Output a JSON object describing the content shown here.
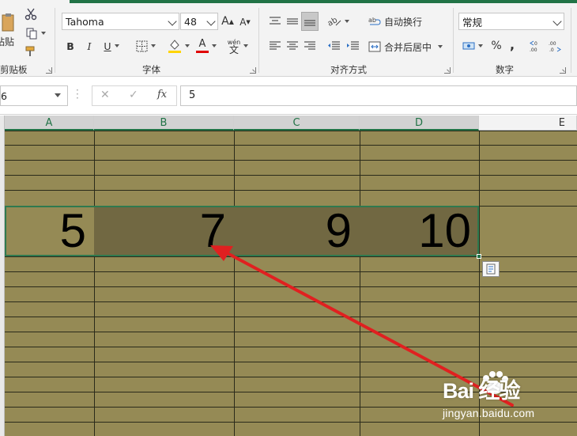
{
  "ribbon": {
    "clipboard": {
      "paste_label": "粘贴",
      "group_label": "剪贴板"
    },
    "font": {
      "font_name": "Tahoma",
      "font_size": "48",
      "grow_font": "A",
      "shrink_font": "A",
      "bold": "B",
      "italic": "I",
      "underline": "U",
      "font_color_glyph": "A",
      "phonetic": "wén",
      "group_label": "字体"
    },
    "alignment": {
      "wrap_text": "自动换行",
      "merge_center": "合并后居中",
      "group_label": "对齐方式"
    },
    "number": {
      "format": "常规",
      "percent": "%",
      "comma": ",",
      "group_label": "数字"
    }
  },
  "formula_bar": {
    "name_box": "6",
    "cancel": "✕",
    "enter": "✓",
    "fx": "fx",
    "value": "5"
  },
  "grid": {
    "columns": [
      "A",
      "B",
      "C",
      "D",
      "E"
    ],
    "selected_row_values": [
      "5",
      "7",
      "9",
      "10"
    ],
    "fill_color": "#958a55",
    "highlight_color": "#716842"
  },
  "watermark": {
    "brand": "Bai 经验",
    "url": "jingyan.baidu.com"
  },
  "annotation": {
    "arrow_color": "#e02020"
  }
}
